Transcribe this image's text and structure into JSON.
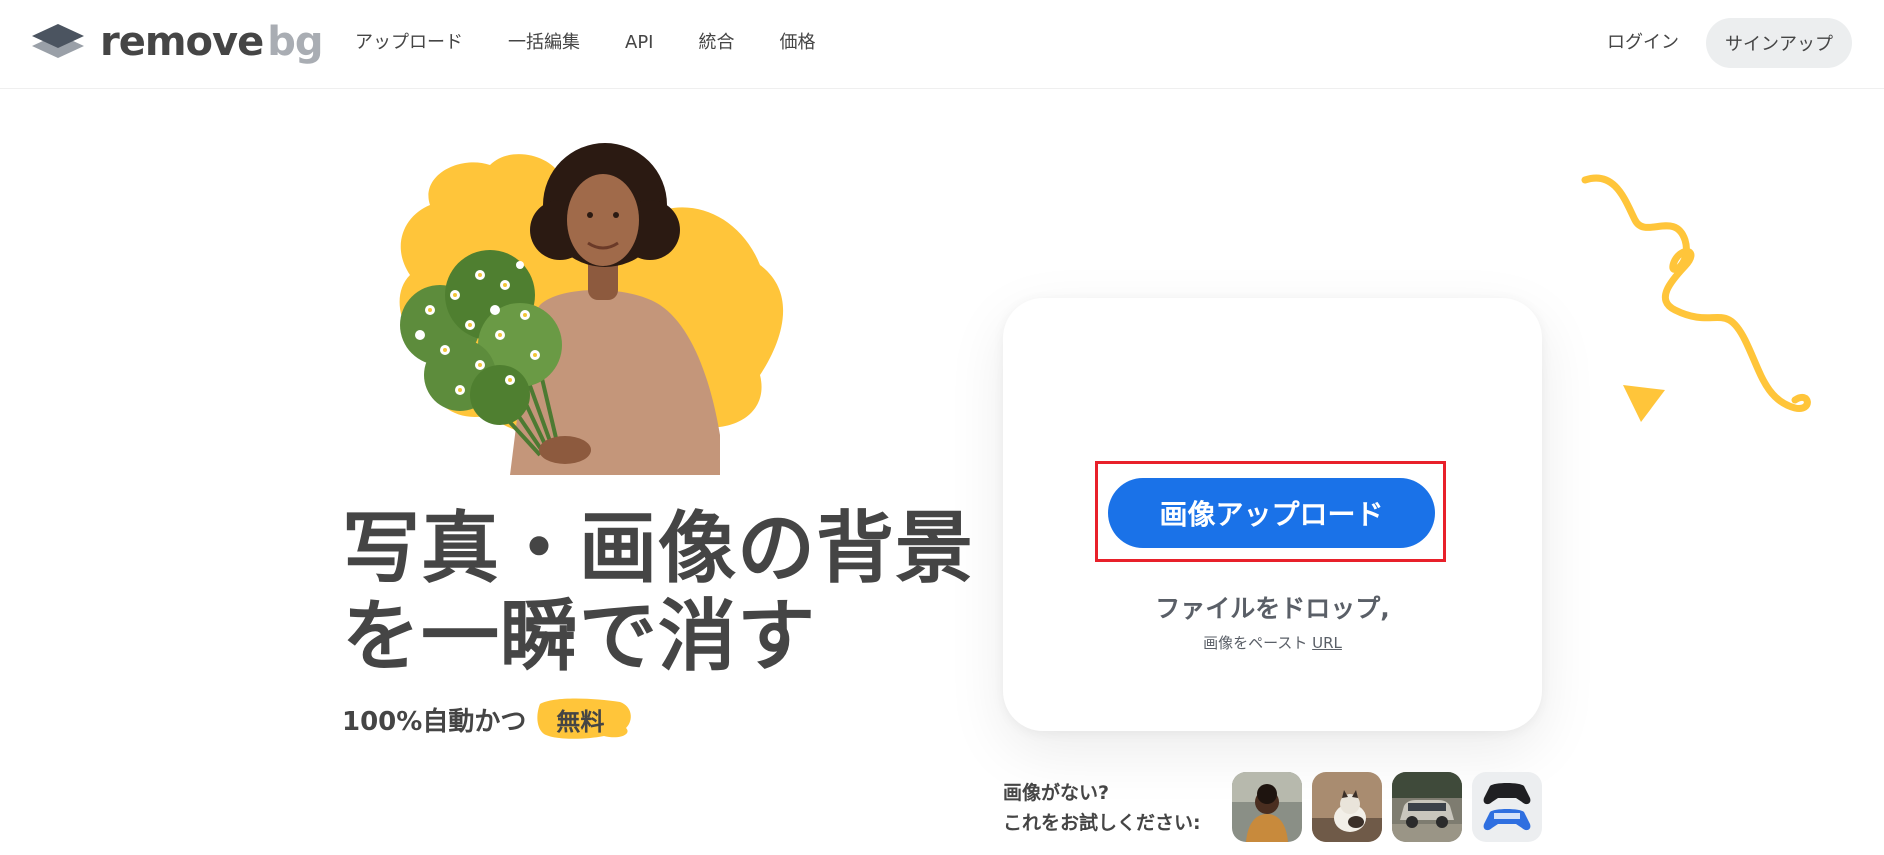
{
  "brand": {
    "name_part1": "remove",
    "name_part2": "bg"
  },
  "nav": {
    "items": [
      "アップロード",
      "一括編集",
      "API",
      "統合",
      "価格"
    ]
  },
  "auth": {
    "login": "ログイン",
    "signup": "サインアップ"
  },
  "hero": {
    "headline_line1": "写真・画像の背景",
    "headline_line2": "を一瞬で消す",
    "sub_text": "100%自動かつ",
    "free_badge": "無料"
  },
  "upload": {
    "button": "画像アップロード",
    "drop_text": "ファイルをドロップ,",
    "paste_text": "画像をペースト",
    "url_link": "URL"
  },
  "samples": {
    "line1": "画像がない?",
    "line2": "これをお試しください:",
    "thumbs": [
      "person-thumb",
      "cat-thumb",
      "car-thumb",
      "gamepad-thumb"
    ]
  },
  "colors": {
    "accent_blue": "#1a72e8",
    "highlight_red": "#e8202a",
    "brand_yellow": "#ffc53a",
    "text_dark": "#454545"
  }
}
